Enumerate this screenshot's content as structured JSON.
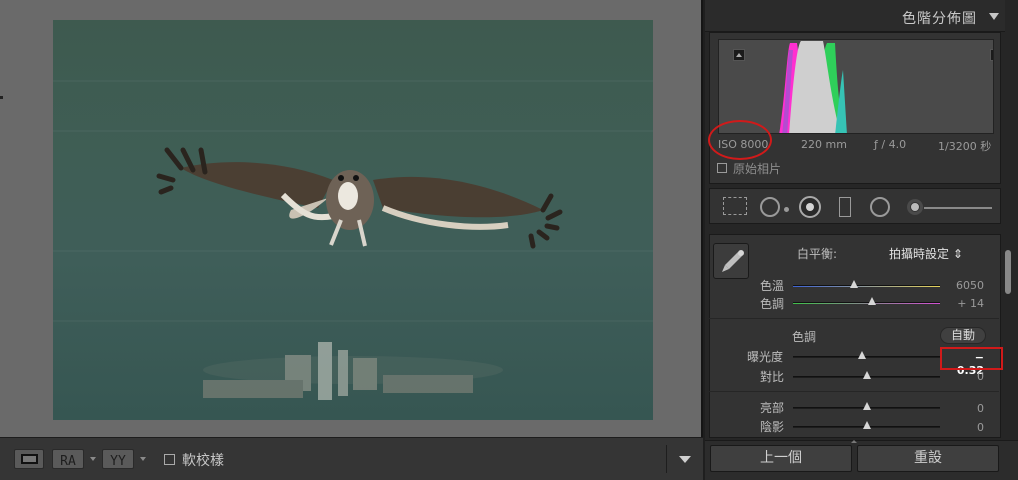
{
  "viewer": {
    "photo_subject": "osprey-in-flight"
  },
  "toolbar": {
    "btn_ra": "RA",
    "btn_yy": "YY",
    "softproof_label": "軟校樣"
  },
  "histogram": {
    "title": "色階分佈圖",
    "iso": "ISO 8000",
    "focal": "220 mm",
    "aperture": "ƒ / 4.0",
    "shutter": "1/3200 秒",
    "original_label": "原始相片"
  },
  "basic": {
    "wb_label": "白平衡:",
    "wb_value": "拍攝時設定 ⇕",
    "temp_label": "色溫",
    "temp_value": "6050",
    "tint_label": "色調",
    "tint_value": "+ 14",
    "tone_label": "色調",
    "auto_label": "自動",
    "exposure_label": "曝光度",
    "exposure_value": "− 0.32",
    "contrast_label": "對比",
    "contrast_value": "0",
    "highlights_label": "亮部",
    "highlights_value": "0",
    "shadows_label": "陰影",
    "shadows_value": "0"
  },
  "nav": {
    "prev_label": "上一個",
    "reset_label": "重設"
  },
  "colors": {
    "highlight_red": "#d11a1a",
    "panel_bg": "#262626",
    "viewer_bg": "#6a6a6a"
  }
}
